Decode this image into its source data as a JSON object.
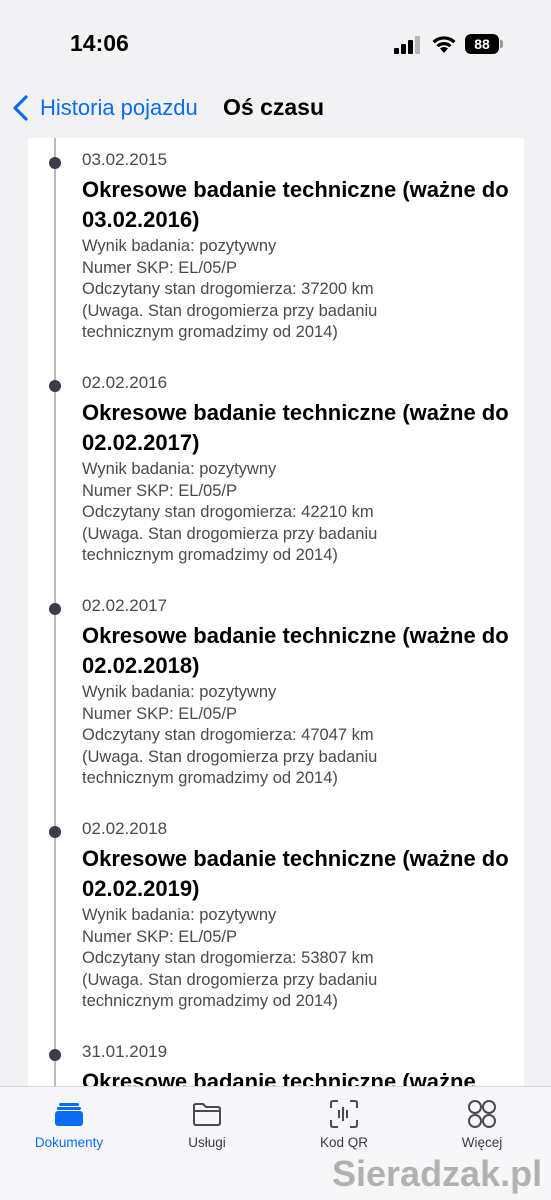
{
  "status": {
    "time": "14:06",
    "battery": "88"
  },
  "nav": {
    "back_label": "Historia pojazdu",
    "title": "Oś czasu"
  },
  "entries": [
    {
      "date": "03.02.2015",
      "title": "Okresowe badanie techniczne (ważne do 03.02.2016)",
      "result": "Wynik badania: pozytywny",
      "skp": "Numer SKP: EL/05/P",
      "odometer": "Odczytany stan drogomierza: 37200 km",
      "note_line1": "(Uwaga. Stan drogomierza przy badaniu",
      "note_line2": "technicznym gromadzimy od 2014)"
    },
    {
      "date": "02.02.2016",
      "title": "Okresowe badanie techniczne (ważne do 02.02.2017)",
      "result": "Wynik badania: pozytywny",
      "skp": "Numer SKP: EL/05/P",
      "odometer": "Odczytany stan drogomierza: 42210 km",
      "note_line1": "(Uwaga. Stan drogomierza przy badaniu",
      "note_line2": "technicznym gromadzimy od 2014)"
    },
    {
      "date": "02.02.2017",
      "title": "Okresowe badanie techniczne (ważne do 02.02.2018)",
      "result": "Wynik badania: pozytywny",
      "skp": "Numer SKP: EL/05/P",
      "odometer": "Odczytany stan drogomierza: 47047 km",
      "note_line1": "(Uwaga. Stan drogomierza przy badaniu",
      "note_line2": "technicznym gromadzimy od 2014)"
    },
    {
      "date": "02.02.2018",
      "title": "Okresowe badanie techniczne (ważne do 02.02.2019)",
      "result": "Wynik badania: pozytywny",
      "skp": "Numer SKP: EL/05/P",
      "odometer": "Odczytany stan drogomierza: 53807 km",
      "note_line1": "(Uwaga. Stan drogomierza przy badaniu",
      "note_line2": "technicznym gromadzimy od 2014)"
    },
    {
      "date": "31.01.2019",
      "title": "Okresowe badanie techniczne (ważne"
    }
  ],
  "tabs": [
    {
      "label": "Dokumenty",
      "icon": "folder-stack-icon",
      "active": true
    },
    {
      "label": "Usługi",
      "icon": "folder-icon",
      "active": false
    },
    {
      "label": "Kod QR",
      "icon": "qr-scan-icon",
      "active": false
    },
    {
      "label": "Więcej",
      "icon": "grid-icon",
      "active": false
    }
  ],
  "watermark": "Sieradzak.pl",
  "colors": {
    "accent": "#0a6cf2",
    "timeline_dot": "#3a3d4a"
  }
}
